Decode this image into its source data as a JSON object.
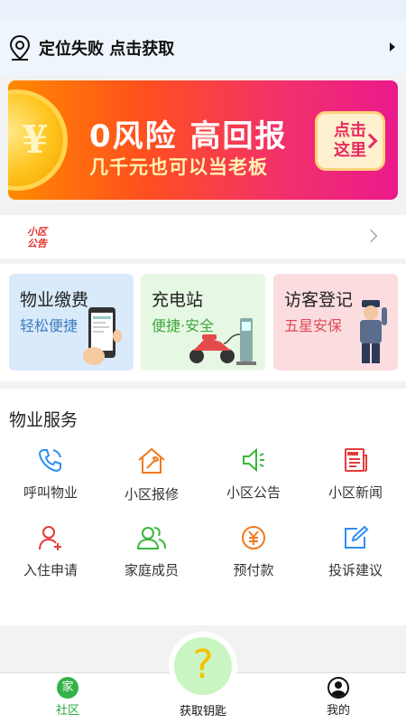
{
  "location": {
    "text": "定位失败 点击获取"
  },
  "banner": {
    "headline": "0风险 高回报",
    "subline": "几千元也可以当老板",
    "cta": "点击这里",
    "coin_symbol": "¥"
  },
  "notice": {
    "badge": "小区公告"
  },
  "cards": [
    {
      "title": "物业缴费",
      "subtitle": "轻松便捷"
    },
    {
      "title": "充电站",
      "subtitle": "便捷·安全"
    },
    {
      "title": "访客登记",
      "subtitle": "五星安保"
    }
  ],
  "services": {
    "heading": "物业服务",
    "items": [
      {
        "label": "呼叫物业",
        "icon": "phone-icon"
      },
      {
        "label": "小区报修",
        "icon": "repair-icon"
      },
      {
        "label": "小区公告",
        "icon": "speaker-icon"
      },
      {
        "label": "小区新闻",
        "icon": "news-icon"
      },
      {
        "label": "入住申请",
        "icon": "add-user-icon"
      },
      {
        "label": "家庭成员",
        "icon": "family-icon"
      },
      {
        "label": "预付款",
        "icon": "yuan-icon"
      },
      {
        "label": "投诉建议",
        "icon": "edit-icon"
      }
    ]
  },
  "tabbar": {
    "community": "社区",
    "community_icon_char": "家",
    "key": "获取钥匙",
    "key_icon_char": "?",
    "me": "我的"
  },
  "colors": {
    "accent": "#28a940",
    "banner_start": "#ff8a00",
    "banner_end": "#ea1a8c"
  }
}
